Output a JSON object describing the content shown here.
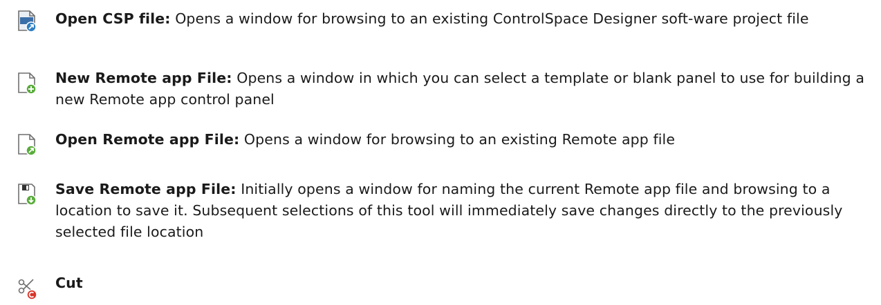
{
  "items": [
    {
      "icon": "open-csp-file-icon",
      "title": "Open CSP file:",
      "description": "Opens a window for browsing to an existing ControlSpace Designer soft-ware project file"
    },
    {
      "icon": "new-remote-app-file-icon",
      "title": "New Remote app File:",
      "description": "Opens a window in which you can select a template or blank panel to use for building a new Remote app control panel"
    },
    {
      "icon": "open-remote-app-file-icon",
      "title": "Open Remote app File:",
      "description": "Opens a window for browsing to an existing Remote app file"
    },
    {
      "icon": "save-remote-app-file-icon",
      "title": "Save Remote app File:",
      "description": "Initially opens a window for naming the current Remote app file and browsing to a location to save it. Subsequent selections of this tool will immediately save changes directly to the previously selected file location"
    },
    {
      "icon": "cut-icon",
      "title": "Cut",
      "description": ""
    }
  ],
  "colors": {
    "blue_accent": "#2f7fc1",
    "green_accent": "#5aac3c",
    "red_accent": "#d9362b",
    "doc_outline": "#6f6f6f"
  }
}
